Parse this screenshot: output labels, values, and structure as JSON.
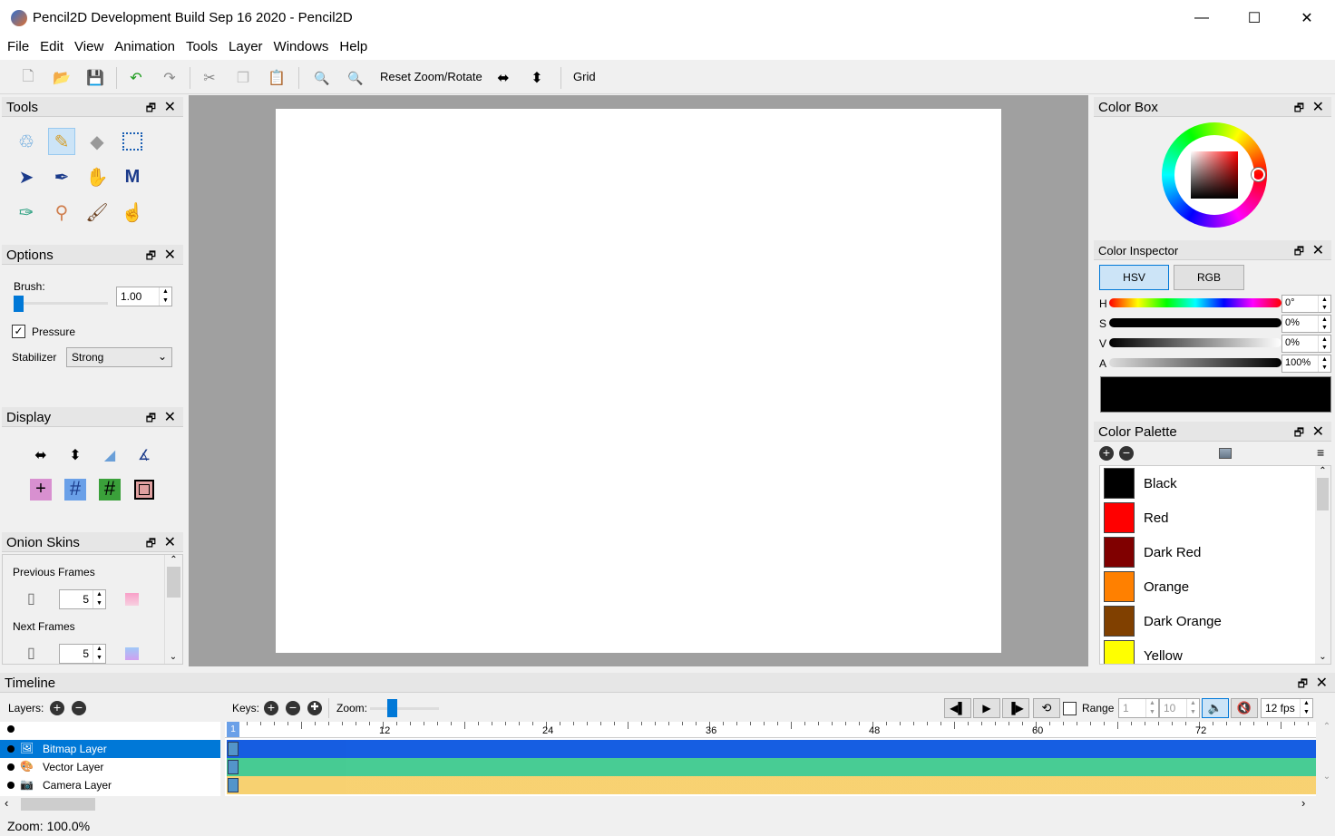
{
  "window": {
    "title": "Pencil2D Development Build Sep 16 2020 - Pencil2D",
    "min": "—",
    "max": "☐",
    "close": "✕"
  },
  "menu": [
    "File",
    "Edit",
    "View",
    "Animation",
    "Tools",
    "Layer",
    "Windows",
    "Help"
  ],
  "toolbar": {
    "reset_zoom": "Reset Zoom/Rotate",
    "grid": "Grid"
  },
  "tools_panel": {
    "title": "Tools"
  },
  "options_panel": {
    "title": "Options",
    "brush_label": "Brush:",
    "brush_value": "1.00",
    "pressure_label": "Pressure",
    "stabilizer_label": "Stabilizer",
    "stabilizer_value": "Strong"
  },
  "display_panel": {
    "title": "Display"
  },
  "onion_panel": {
    "title": "Onion Skins",
    "prev_label": "Previous Frames",
    "prev_value": "5",
    "next_label": "Next Frames",
    "next_value": "5"
  },
  "color_box": {
    "title": "Color Box"
  },
  "color_inspector": {
    "title": "Color Inspector",
    "tab_hsv": "HSV",
    "tab_rgb": "RGB",
    "h_label": "H",
    "h_value": "0°",
    "s_label": "S",
    "s_value": "0%",
    "v_label": "V",
    "v_value": "0%",
    "a_label": "A",
    "a_value": "100%",
    "current_color": "#000000"
  },
  "color_palette": {
    "title": "Color Palette",
    "colors": [
      {
        "name": "Black",
        "hex": "#000000"
      },
      {
        "name": "Red",
        "hex": "#ff0000"
      },
      {
        "name": "Dark Red",
        "hex": "#800000"
      },
      {
        "name": "Orange",
        "hex": "#ff8000"
      },
      {
        "name": "Dark Orange",
        "hex": "#804000"
      },
      {
        "name": "Yellow",
        "hex": "#ffff00"
      }
    ]
  },
  "timeline": {
    "title": "Timeline",
    "layers_label": "Layers:",
    "keys_label": "Keys:",
    "zoom_label": "Zoom:",
    "range_label": "Range",
    "range_start": "1",
    "range_end": "10",
    "fps": "12 fps",
    "current_frame": "1",
    "ruler": [
      "12",
      "24",
      "36",
      "48",
      "60",
      "72"
    ],
    "layers": [
      {
        "name": "Bitmap Layer",
        "selected": true,
        "color": "#0a55e0"
      },
      {
        "name": "Vector Layer",
        "selected": false,
        "color": "#3ec98e"
      },
      {
        "name": "Camera Layer",
        "selected": false,
        "color": "#f7cf6a"
      }
    ]
  },
  "status": {
    "zoom": "Zoom: 100.0%"
  }
}
